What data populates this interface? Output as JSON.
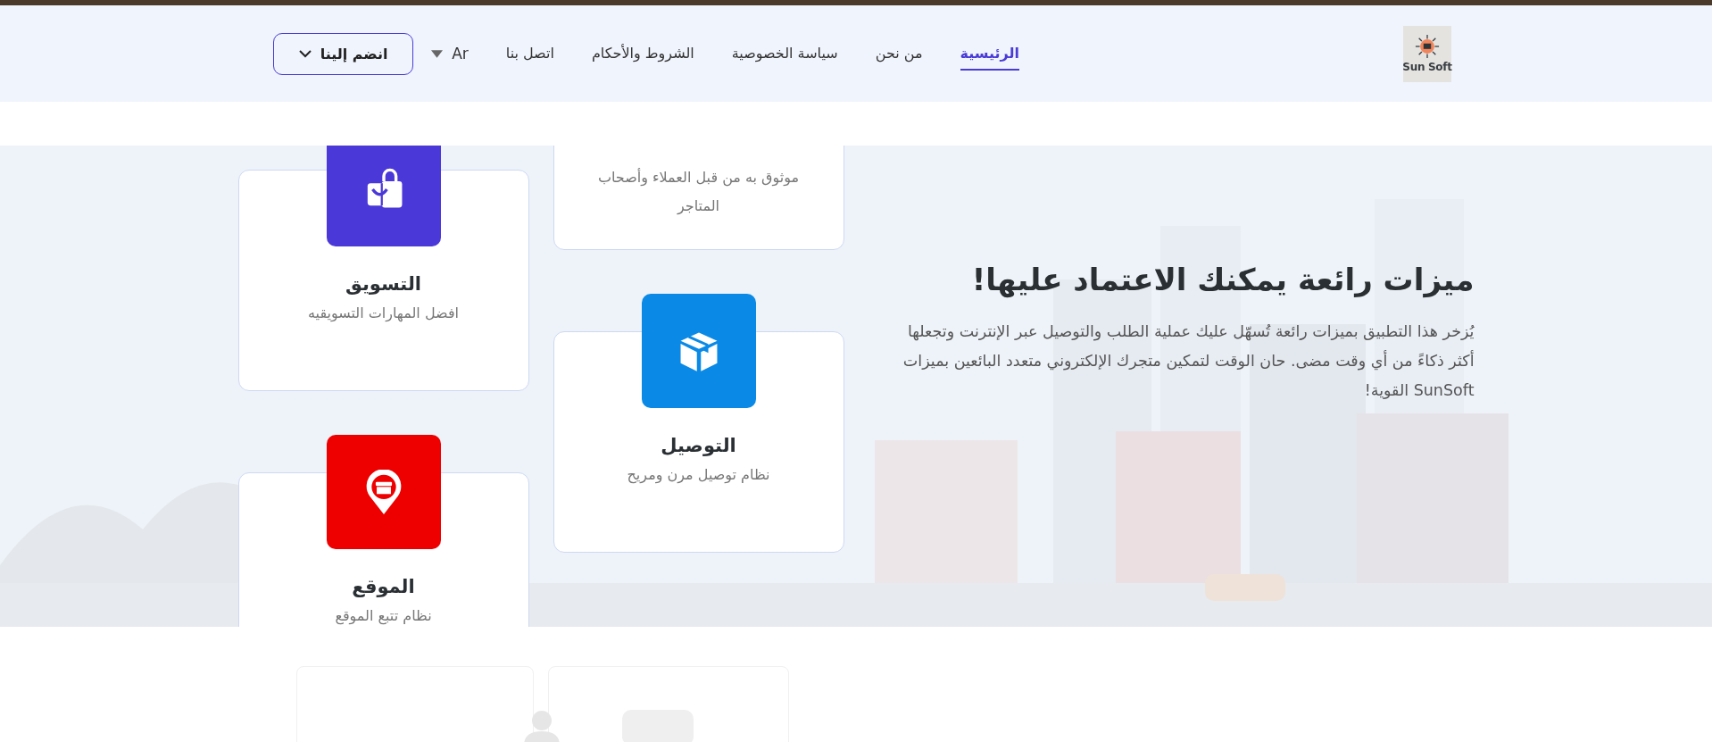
{
  "logo": {
    "text": "Sun Soft"
  },
  "nav": [
    {
      "label": "الرئيسية",
      "selected": true
    },
    {
      "label": "من نحن",
      "selected": false
    },
    {
      "label": "سياسة الخصوصية",
      "selected": false
    },
    {
      "label": "الشروط والأحكام",
      "selected": false
    },
    {
      "label": "اتصل بنا",
      "selected": false
    }
  ],
  "language": {
    "label": "Ar"
  },
  "join_button": {
    "label": "انضم إلينا"
  },
  "features": {
    "title": "ميزات رائعة يمكنك الاعتماد عليها!",
    "description": "يُزخر هذا التطبيق بميزات رائعة تُسهّل عليك عملية الطلب والتوصيل عبر الإنترنت وتجعلها أكثر ذكاءً من أي وقت مضى. حان الوقت لتمكين متجرك الإلكتروني متعدد البائعين بميزات SunSoft القوية!",
    "columns": [
      {
        "cards": [
          {
            "description": "موثوق به من قبل العملاء وأصحاب المتاجر"
          },
          {
            "kind": "box",
            "color": "#0a8ae6",
            "title": "التوصيل",
            "description": "نظام توصيل مرن ومريح"
          }
        ]
      },
      {
        "cards": [
          {
            "kind": "bag",
            "color": "#4b38d8",
            "title": "التسويق",
            "description": "افضل المهارات التسويقيه"
          },
          {
            "kind": "pin",
            "color": "#ee0000",
            "title": "الموقع",
            "description": "نظام تتبع الموقع"
          }
        ]
      }
    ]
  }
}
